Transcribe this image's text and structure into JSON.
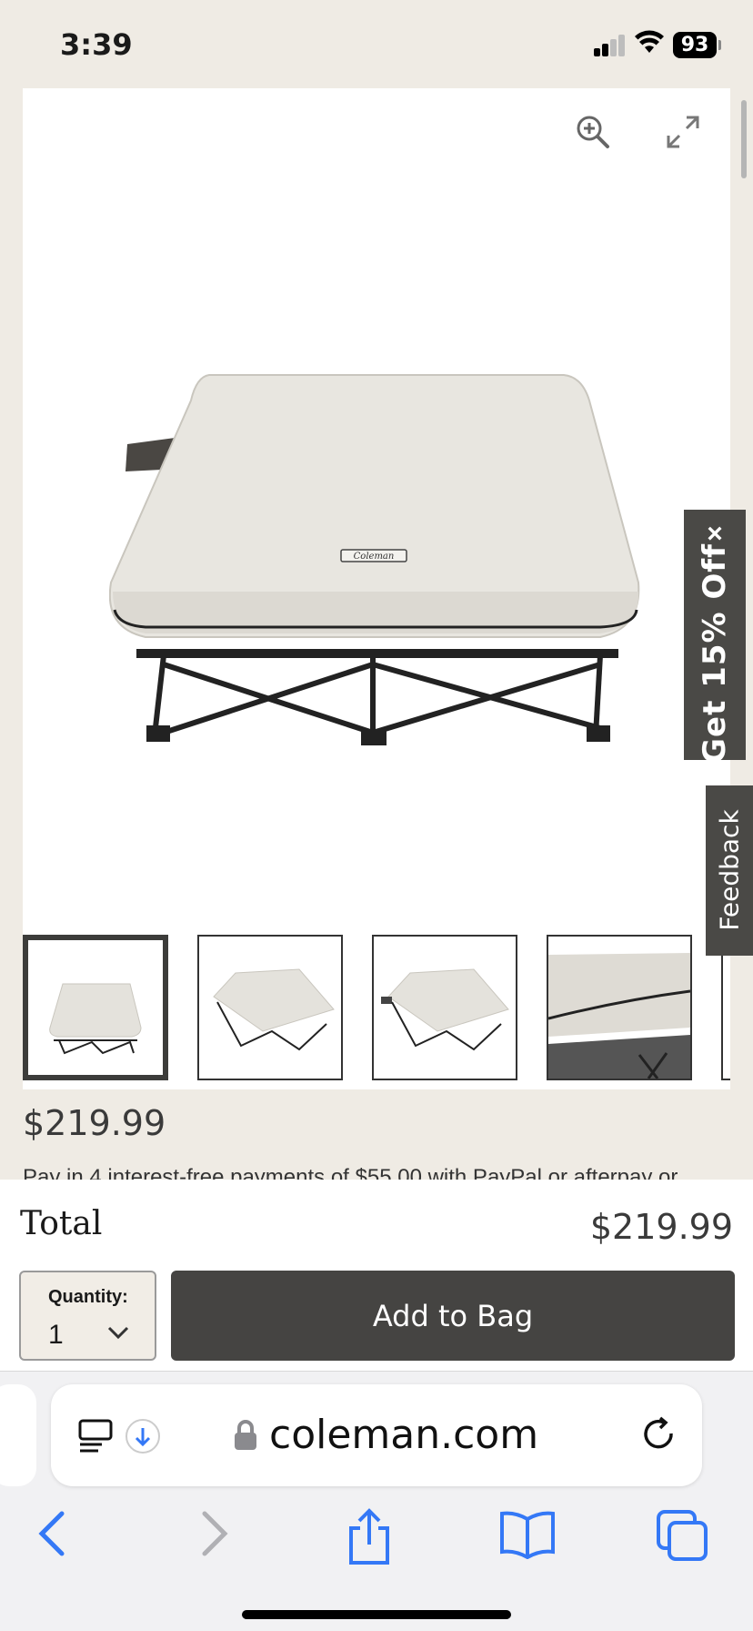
{
  "status_bar": {
    "time": "3:39",
    "battery": "93"
  },
  "gallery": {
    "thumbnail_count": 4,
    "product_brand_mark": "Coleman"
  },
  "side_tabs": {
    "promo": "Get 15% Off",
    "promo_close": "×",
    "feedback": "Feedback"
  },
  "product": {
    "price": "$219.99",
    "paylater_text": "Pay in 4 interest-free payments of $55.00 with PayPal or afterpay or"
  },
  "purchase_bar": {
    "total_label": "Total",
    "total_value": "$219.99",
    "quantity_label": "Quantity:",
    "quantity_value": "1",
    "add_button": "Add to Bag"
  },
  "browser": {
    "url": "coleman.com"
  },
  "colors": {
    "background": "#efebe4",
    "dark_button": "#454442",
    "tab_bg": "#4a4946",
    "ios_blue": "#3478f6"
  }
}
